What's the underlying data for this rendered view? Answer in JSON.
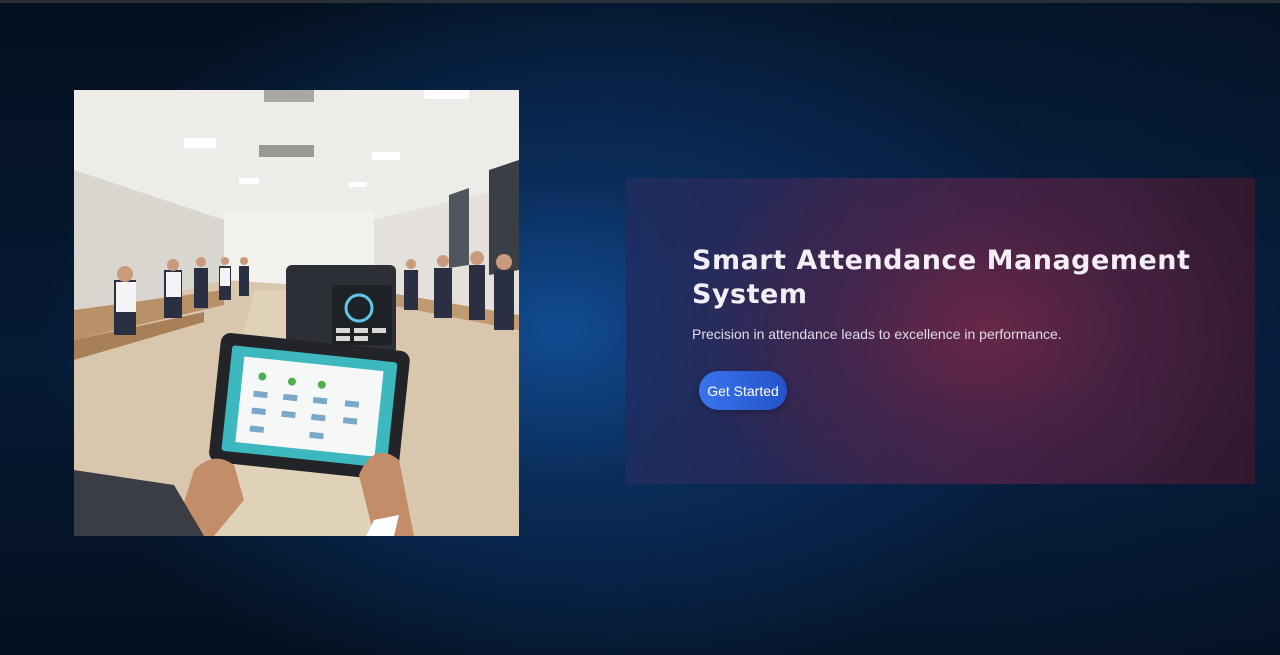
{
  "hero": {
    "image_alt": "Tablet attendance terminal in a busy office hall",
    "title": "Smart Attendance Management System",
    "subtitle": "Precision in attendance leads to excellence in performance.",
    "cta_label": "Get Started"
  },
  "colors": {
    "background": "#030b18",
    "accent_button": "#3a73ee",
    "card_tint": "#5a2346",
    "title_text": "#f2eef4"
  }
}
